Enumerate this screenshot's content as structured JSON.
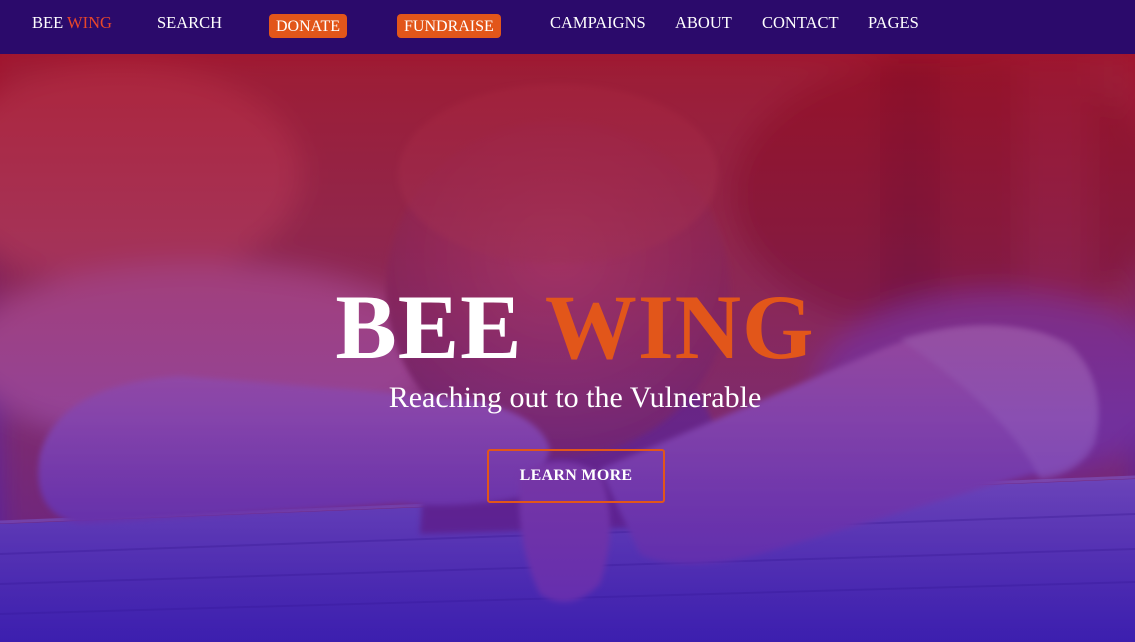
{
  "nav": {
    "brand_prefix": "BEE",
    "brand_accent": "WING",
    "search": "SEARCH",
    "donate": "DONATE",
    "fundraise": "FUNDRAISE",
    "campaigns": "CAMPAIGNS",
    "about": "ABOUT",
    "contact": "CONTACT",
    "pages": "PAGES"
  },
  "hero": {
    "title_prefix": "BEE",
    "title_accent": "WING",
    "subtitle": "Reaching out to the Vulnerable",
    "cta_label": "LEARN MORE"
  },
  "colors": {
    "nav_background": "#2b0a6b",
    "accent": "#e2561a",
    "text": "#ffffff",
    "hero_overlay_top": "#aa0a1e",
    "hero_overlay_bottom": "#3c14be"
  }
}
